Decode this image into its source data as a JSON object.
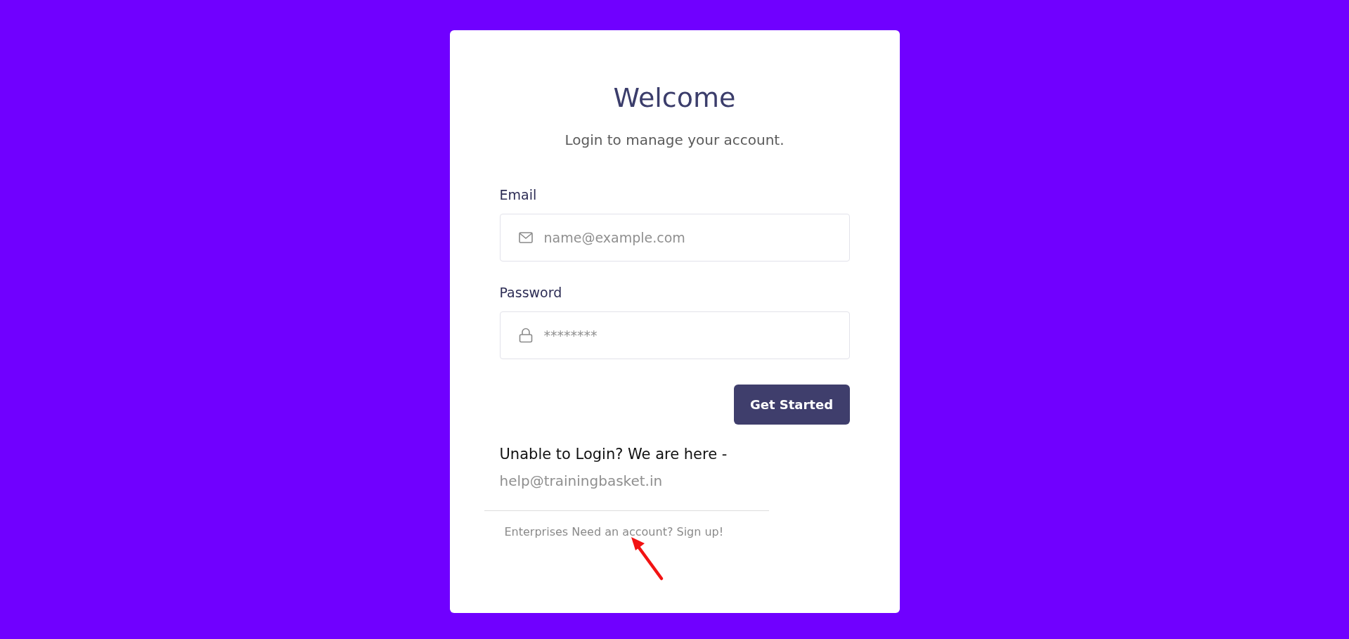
{
  "card": {
    "title": "Welcome",
    "subtitle": "Login to manage your account.",
    "fields": [
      {
        "kind": "email",
        "label": "Email",
        "placeholder": "name@example.com"
      },
      {
        "kind": "password",
        "label": "Password",
        "placeholder": "********"
      }
    ],
    "submit": "Get Started",
    "help_text": "Unable to Login? We are here -",
    "help_email": "help@trainingbasket.in",
    "signup_text": "Enterprises Need an account? Sign up!"
  }
}
